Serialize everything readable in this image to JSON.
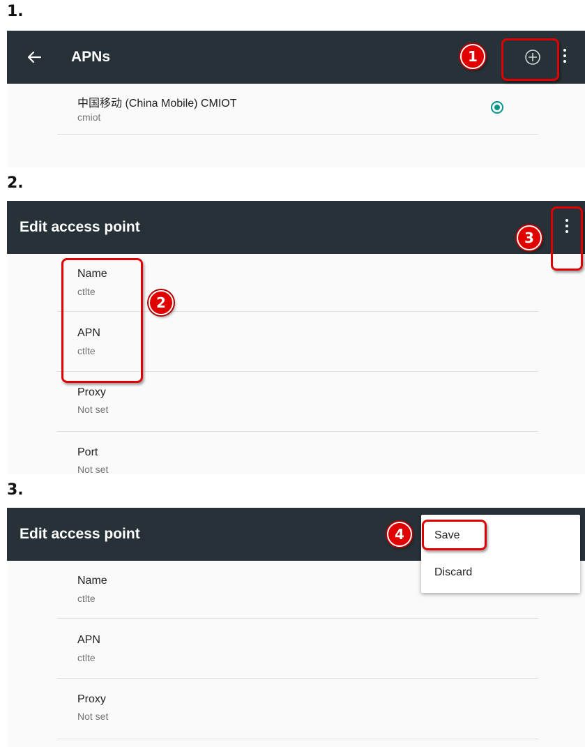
{
  "steps": [
    {
      "number": "1.",
      "toolbar": {
        "title": "APNs",
        "back_icon": "arrow-left-icon",
        "add_icon": "add-circle-icon",
        "more_icon": "more-vert-icon"
      },
      "apn_entry": {
        "name": "中国移动 (China Mobile) CMIOT",
        "apn": "cmiot",
        "selected": true
      },
      "callout": "1"
    },
    {
      "number": "2.",
      "toolbar": {
        "title": "Edit access point",
        "more_icon": "more-vert-icon"
      },
      "fields": [
        {
          "label": "Name",
          "value": "ctlte"
        },
        {
          "label": "APN",
          "value": "ctlte"
        },
        {
          "label": "Proxy",
          "value": "Not set"
        },
        {
          "label": "Port",
          "value": "Not set"
        }
      ],
      "callouts": [
        "2",
        "3"
      ]
    },
    {
      "number": "3.",
      "toolbar": {
        "title": "Edit access point"
      },
      "fields": [
        {
          "label": "Name",
          "value": "ctlte"
        },
        {
          "label": "APN",
          "value": "ctlte"
        },
        {
          "label": "Proxy",
          "value": "Not set"
        }
      ],
      "menu": {
        "items": [
          "Save",
          "Discard"
        ]
      },
      "callout": "4"
    }
  ],
  "colors": {
    "toolbar": "#263238",
    "accent": "#009688",
    "annotation": "#e00000",
    "background": "#fafafa"
  }
}
